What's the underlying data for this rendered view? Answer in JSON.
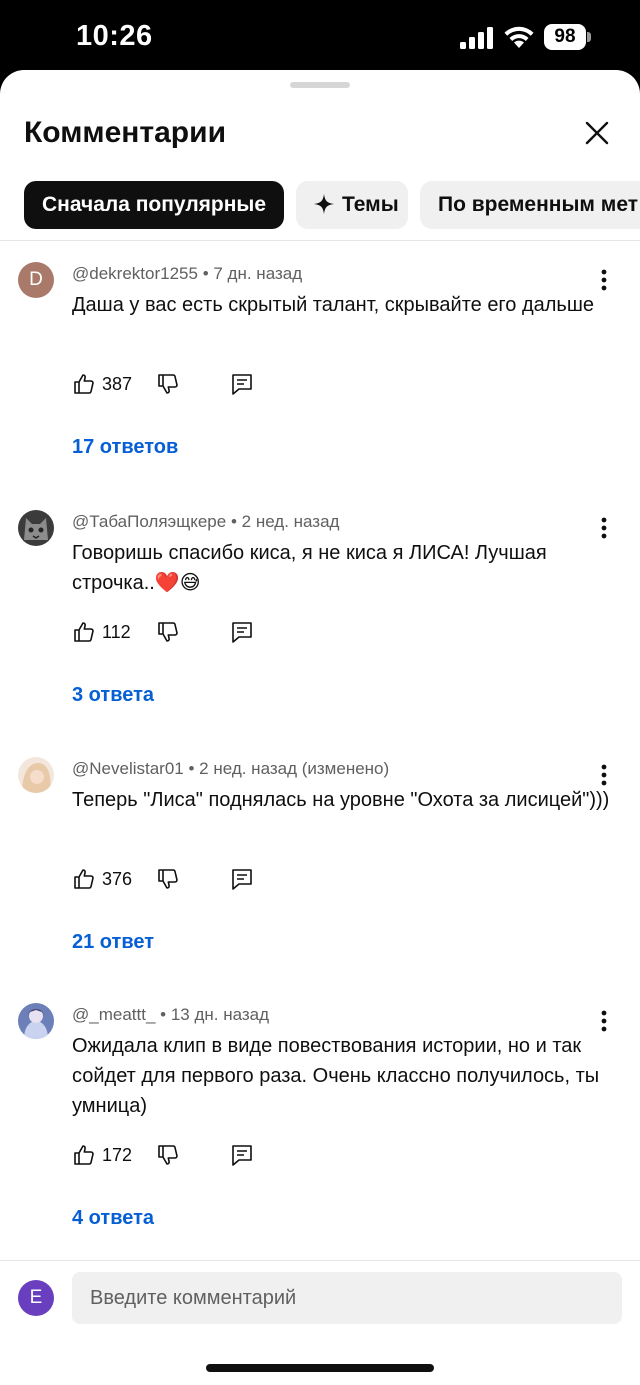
{
  "status_bar": {
    "time": "10:26",
    "battery": "98"
  },
  "sheet": {
    "title": "Комментарии",
    "chips": {
      "popular": "Сначала популярные",
      "topics": "Темы",
      "by_time": "По временным мет"
    }
  },
  "comments": [
    {
      "avatar_letter": "D",
      "author": "@dekrektor1255",
      "time": "7 дн. назад",
      "text": "Даша у вас есть скрытый талант, скрывайте его дальше",
      "likes": "387",
      "replies": "17 ответов"
    },
    {
      "author": "@ТабаПоляэщкере",
      "time": "2 нед. назад",
      "text": "Говоришь спасибо киса, я не киса я ЛИСА! Лучшая строчка..❤️😅",
      "likes": "112",
      "replies": "3 ответа"
    },
    {
      "author": "@Nevelistar01",
      "time": "2 нед. назад (изменено)",
      "text": "Теперь \"Лиса\" поднялась на уровне \"Охота за лисицей\")))",
      "likes": "376",
      "replies": "21 ответ"
    },
    {
      "author": "@_meattt_",
      "time": "13 дн. назад",
      "text": "Ожидала клип в виде повествования истории, но и так сойдет для первого раза. Очень классно получилось, ты умница)",
      "likes": "172",
      "replies": "4 ответа"
    }
  ],
  "footer": {
    "avatar_letter": "E",
    "placeholder": "Введите комментарий"
  },
  "colors": {
    "accent_link": "#065fd4",
    "chip_active": "#0f0f0f",
    "chip_inactive": "#f0f0f0",
    "user_avatar": "#6a3fbf"
  }
}
